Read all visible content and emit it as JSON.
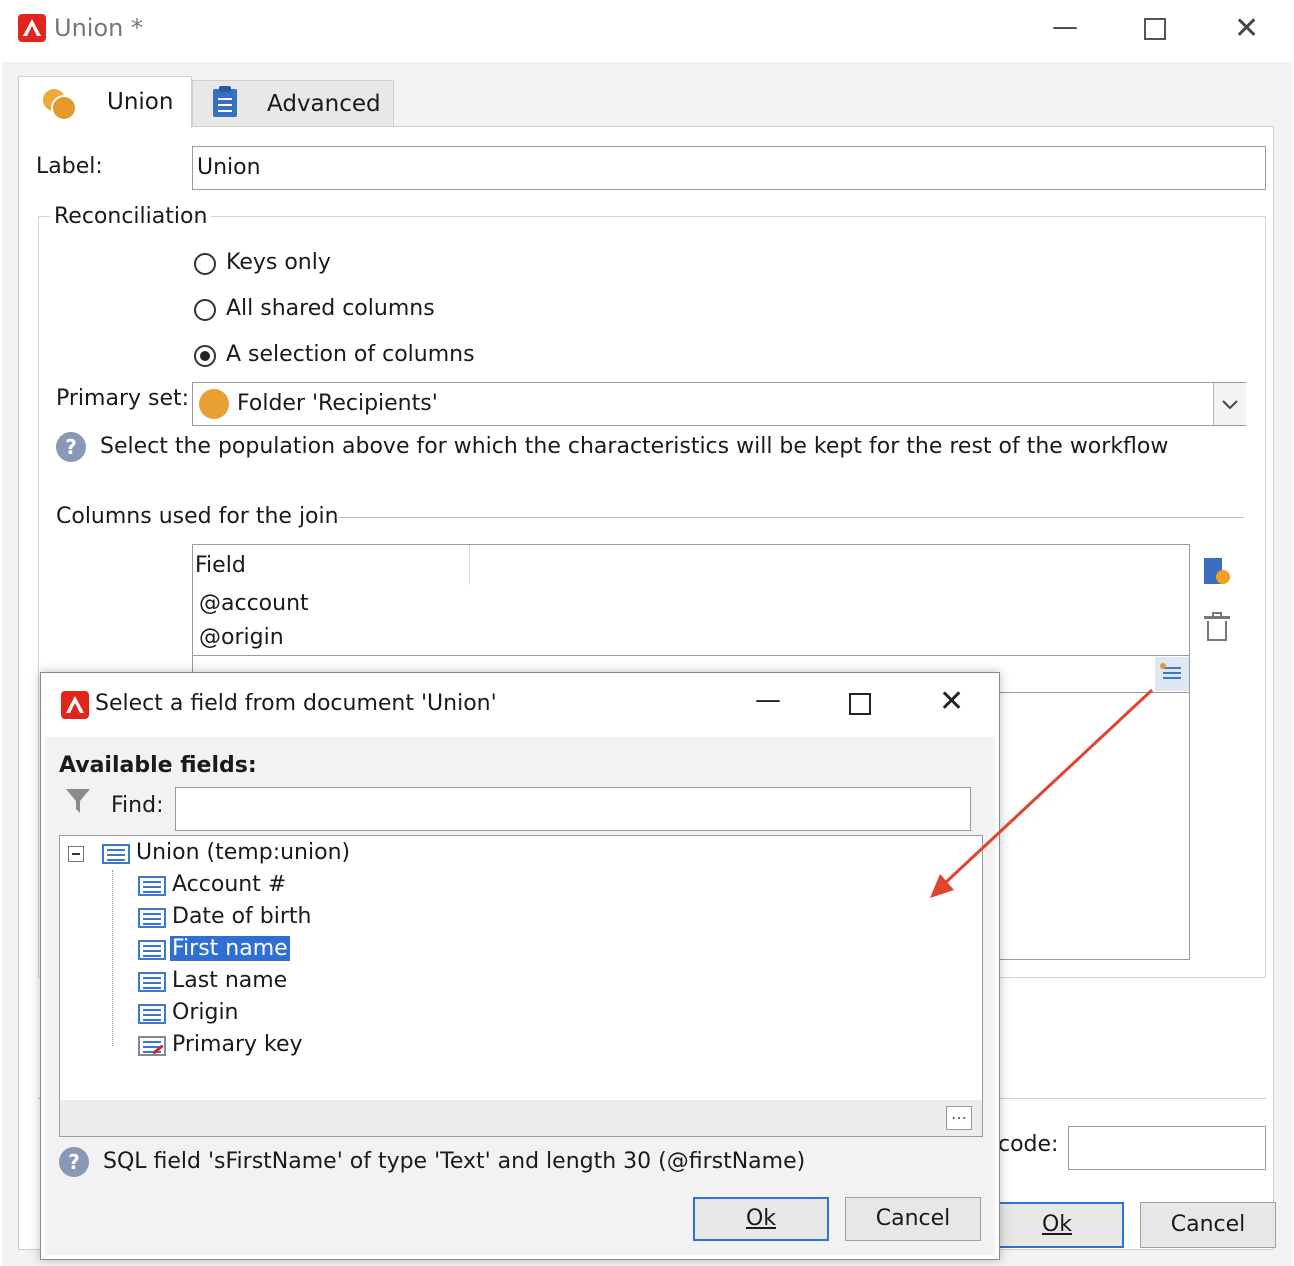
{
  "window": {
    "title": "Union *"
  },
  "tabs": [
    {
      "label": "Union"
    },
    {
      "label": "Advanced"
    }
  ],
  "form": {
    "label_caption": "Label:",
    "label_value": "Union",
    "reconciliation_legend": "Reconciliation",
    "radios": [
      {
        "label": "Keys only",
        "checked": false
      },
      {
        "label": "All shared columns",
        "checked": false
      },
      {
        "label": "A selection of columns",
        "checked": true
      }
    ],
    "primary_set_caption": "Primary set:",
    "primary_set_value": "Folder 'Recipients'",
    "help_text": "Select the population above for which the characteristics will be kept for the rest of the workflow",
    "join_legend": "Columns used for the join",
    "join_table": {
      "header": "Field",
      "rows": [
        "@account",
        "@origin"
      ]
    },
    "code_caption": "code:",
    "code_value": "",
    "ok_label": "Ok",
    "cancel_label": "Cancel"
  },
  "dialog": {
    "title": "Select a field from document 'Union'",
    "available_fields_label": "Available fields:",
    "find_label": "Find:",
    "find_value": "",
    "tree": {
      "root": "Union (temp:union)",
      "items": [
        "Account #",
        "Date of birth",
        "First name",
        "Last name",
        "Origin",
        "Primary key"
      ],
      "selected": "First name"
    },
    "info_text": "SQL field 'sFirstName' of type 'Text' and length 30 (@firstName)",
    "ok_label": "Ok",
    "cancel_label": "Cancel"
  },
  "colors": {
    "accent": "#2a74d4",
    "selection": "#2f6fd3",
    "brand": "#e1251b",
    "arrow": "#e0432f"
  }
}
